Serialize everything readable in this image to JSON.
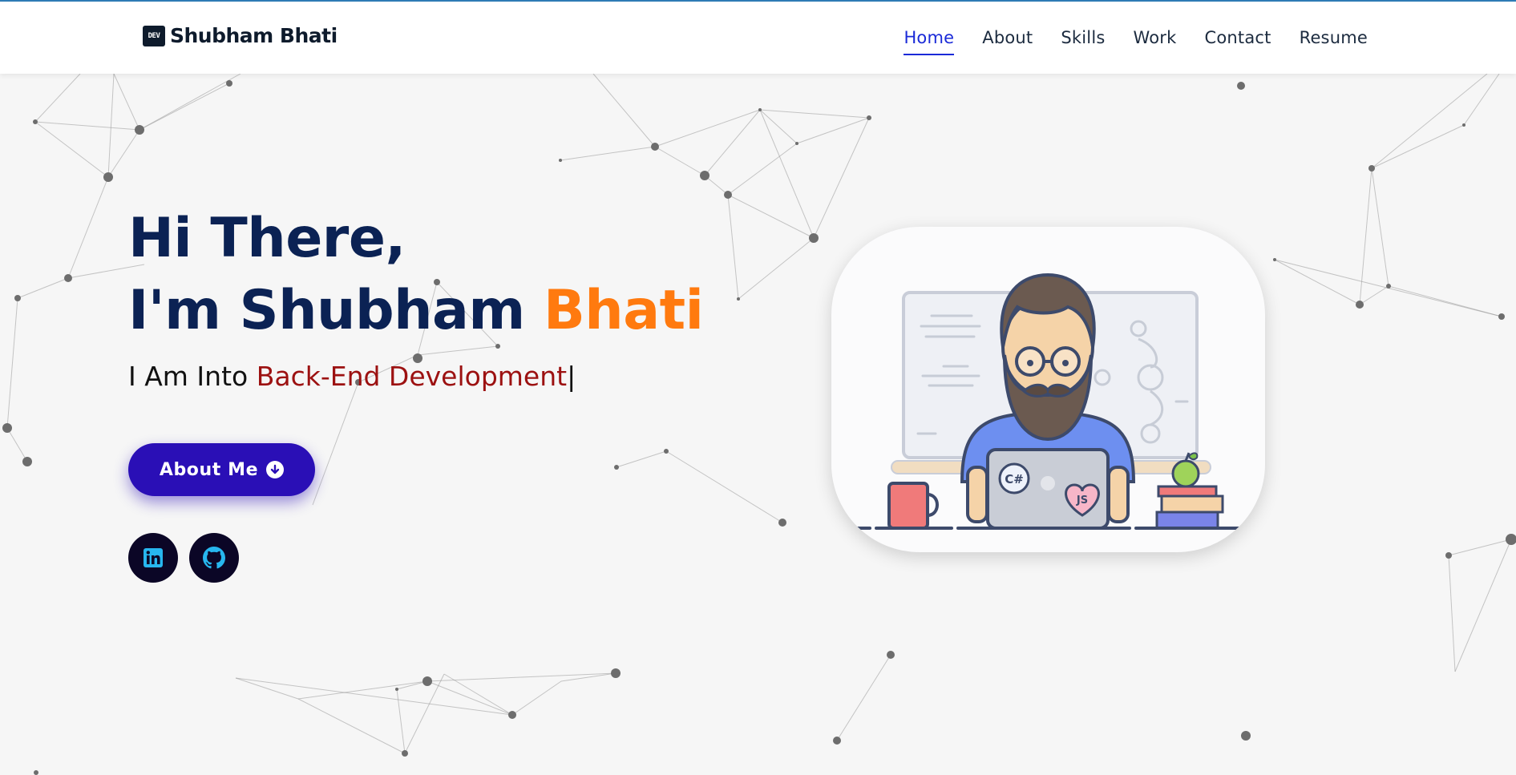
{
  "header": {
    "logo_badge": "DEV",
    "logo_text": "Shubham Bhati",
    "nav": [
      "Home",
      "About",
      "Skills",
      "Work",
      "Contact",
      "Resume"
    ],
    "active_nav": "Home"
  },
  "hero": {
    "greeting": "Hi There,",
    "name_prefix": "I'm Shubham ",
    "name_accent": "Bhati",
    "typed_prefix": "I Am Into ",
    "typed_role": "Back-End Development",
    "cursor": "|",
    "about_button": "About Me"
  },
  "social": {
    "linkedin_icon": "linkedin-icon",
    "github_icon": "github-icon"
  },
  "illustration": {
    "description_icon": "developer-illustration",
    "laptop_badges": [
      "C#",
      "JS"
    ]
  },
  "colors": {
    "primary_dark": "#0b2254",
    "accent_orange": "#ff7a0f",
    "accent_red": "#9c1111",
    "button_blue": "#2a0fb6",
    "nav_active": "#1a2ad8"
  }
}
